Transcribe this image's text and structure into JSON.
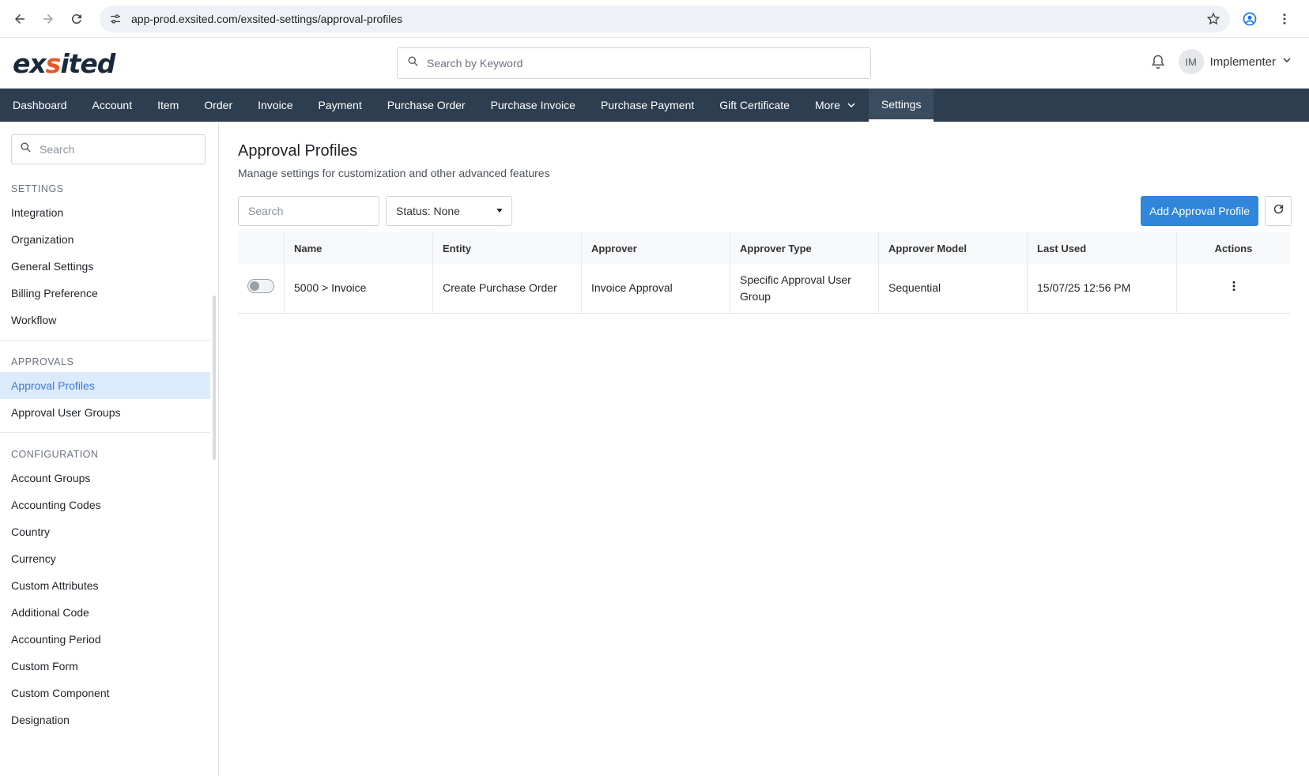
{
  "browser": {
    "url": "app-prod.exsited.com/exsited-settings/approval-profiles"
  },
  "header": {
    "logo_text": "exsited",
    "search_placeholder": "Search by Keyword",
    "avatar_initials": "IM",
    "user_name": "Implementer"
  },
  "nav": {
    "items": [
      {
        "label": "Dashboard"
      },
      {
        "label": "Account"
      },
      {
        "label": "Item"
      },
      {
        "label": "Order"
      },
      {
        "label": "Invoice"
      },
      {
        "label": "Payment"
      },
      {
        "label": "Purchase Order"
      },
      {
        "label": "Purchase Invoice"
      },
      {
        "label": "Purchase Payment"
      },
      {
        "label": "Gift Certificate"
      },
      {
        "label": "More"
      },
      {
        "label": "Settings"
      }
    ]
  },
  "sidebar": {
    "search_placeholder": "Search",
    "settings_title": "SETTINGS",
    "settings_items": [
      "Integration",
      "Organization",
      "General Settings",
      "Billing Preference",
      "Workflow"
    ],
    "approvals_title": "APPROVALS",
    "approvals_items": [
      "Approval Profiles",
      "Approval User Groups"
    ],
    "configuration_title": "CONFIGURATION",
    "configuration_items": [
      "Account Groups",
      "Accounting Codes",
      "Country",
      "Currency",
      "Custom Attributes",
      "Additional Code",
      "Accounting Period",
      "Custom Form",
      "Custom Component",
      "Designation"
    ]
  },
  "main": {
    "title": "Approval Profiles",
    "subtitle": "Manage settings for customization and other advanced features",
    "search_placeholder": "Search",
    "status_label": "Status: None",
    "add_button": "Add Approval Profile",
    "columns": [
      "Name",
      "Entity",
      "Approver",
      "Approver Type",
      "Approver Model",
      "Last Used",
      "Actions"
    ],
    "rows": [
      {
        "enabled": false,
        "name": "5000 > Invoice",
        "entity": "Create Purchase Order",
        "approver": "Invoice Approval",
        "approver_type": "Specific Approval User Group",
        "approver_model": "Sequential",
        "last_used": "15/07/25 12:56 PM"
      }
    ]
  },
  "colors": {
    "nav_bg": "#2d3e50",
    "accent": "#2f86db",
    "logo_accent": "#e8572a",
    "active_item_bg": "#dcebfb"
  }
}
